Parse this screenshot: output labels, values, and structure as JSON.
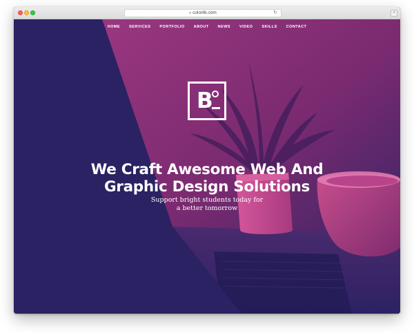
{
  "browser": {
    "url": "colorlib.com",
    "lock_icon": "lock-icon",
    "reload_icon": "reload-icon",
    "reload_glyph": "↻",
    "tab_button_glyph": "+"
  },
  "nav": {
    "items": [
      "HOME",
      "SERVICES",
      "PORTFOLIO",
      "ABOUT",
      "NEWS",
      "VIDEO",
      "SKILLS",
      "CONTACT"
    ]
  },
  "logo": {
    "letter": "B",
    "description_icon": "bo-logo-icon"
  },
  "hero": {
    "headline_line1": "We Craft Awesome Web And",
    "headline_line2": "Graphic Design Solutions",
    "sub_line1": "Support bright students today for",
    "sub_line2": "a better tomorrow"
  },
  "colors": {
    "navy": "#2a2262",
    "magenta": "#8a2f78",
    "pink": "#c04484",
    "white": "#ffffff"
  }
}
